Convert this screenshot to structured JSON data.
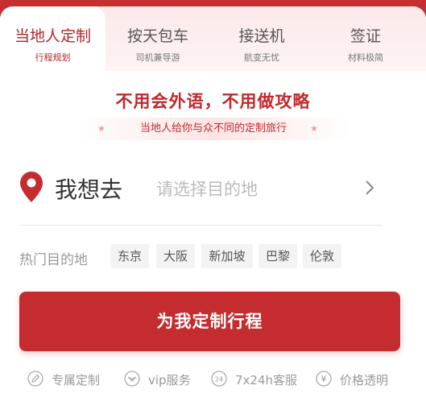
{
  "tabs": [
    {
      "title": "当地人定制",
      "subtitle": "行程规划"
    },
    {
      "title": "按天包车",
      "subtitle": "司机兼导游"
    },
    {
      "title": "接送机",
      "subtitle": "航变无忧"
    },
    {
      "title": "签证",
      "subtitle": "材料极简"
    }
  ],
  "slogan": "不用会外语，不用做攻略",
  "subline": "当地人给你与众不同的定制旅行",
  "destination": {
    "label": "我想去",
    "placeholder": "请选择目的地"
  },
  "hot": {
    "label": "热门目的地",
    "items": [
      "东京",
      "大阪",
      "新加坡",
      "巴黎",
      "伦敦"
    ]
  },
  "cta": "为我定制行程",
  "features": [
    {
      "label": "专属定制",
      "icon": "pencil-circle-icon"
    },
    {
      "label": "vip服务",
      "icon": "vip-badge-icon"
    },
    {
      "label": "7x24h客服",
      "icon": "24h-icon"
    },
    {
      "label": "价格透明",
      "icon": "yen-icon"
    }
  ],
  "colors": {
    "brand": "#c42c2f",
    "active_tab_text": "#b0262a",
    "muted": "#999999"
  }
}
